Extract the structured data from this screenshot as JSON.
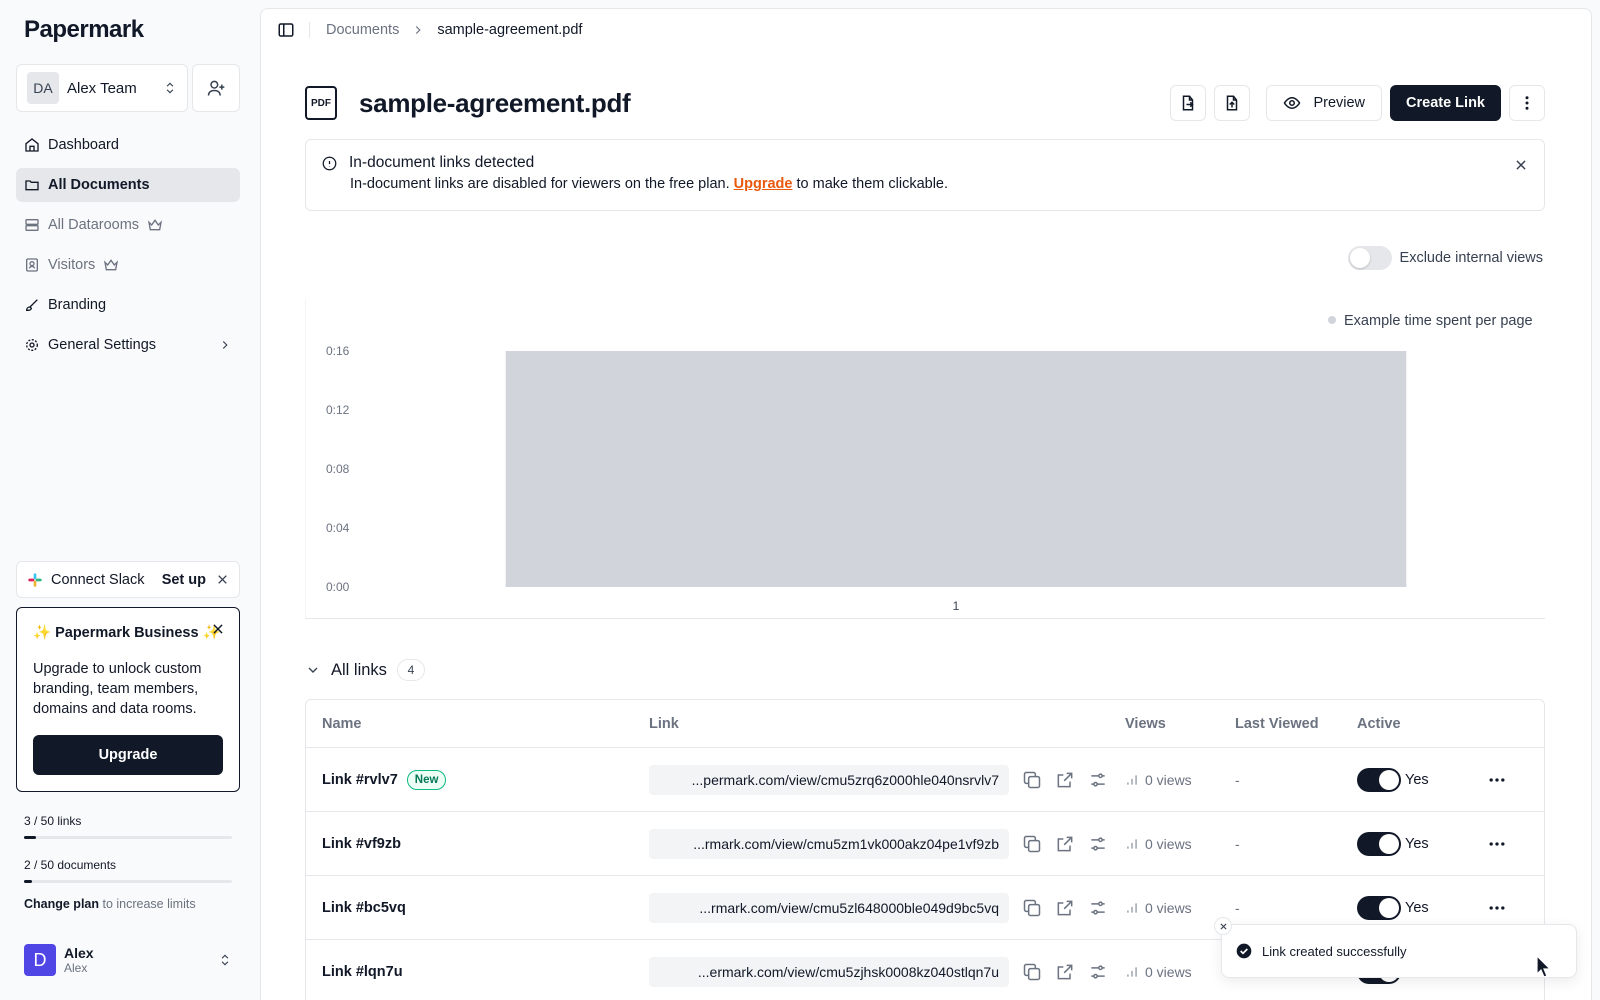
{
  "sidebar": {
    "logo": "Papermark",
    "team": {
      "initials": "DA",
      "name": "Alex Team"
    },
    "nav": [
      {
        "label": "Dashboard"
      },
      {
        "label": "All Documents"
      },
      {
        "label": "All Datarooms"
      },
      {
        "label": "Visitors"
      },
      {
        "label": "Branding"
      },
      {
        "label": "General Settings"
      }
    ],
    "slack": {
      "label": "Connect Slack",
      "action": "Set up"
    },
    "business": {
      "title": "✨ Papermark Business ✨",
      "text": "Upgrade to unlock custom branding, team members, domains and data rooms.",
      "button": "Upgrade"
    },
    "limits": [
      {
        "label": "3 / 50 links",
        "fraction": 0.06
      },
      {
        "label": "2 / 50 documents",
        "fraction": 0.04
      }
    ],
    "change_plan": {
      "bold": "Change plan",
      "rest": " to increase limits"
    },
    "user": {
      "initial": "D",
      "name": "Alex",
      "sub": "Alex"
    }
  },
  "breadcrumb": {
    "parent": "Documents",
    "current": "sample-agreement.pdf"
  },
  "document": {
    "badge": "PDF",
    "title": "sample-agreement.pdf",
    "preview_label": "Preview",
    "create_label": "Create Link"
  },
  "alert": {
    "title": "In-document links detected",
    "body_before": "In-document links are disabled for viewers on the free plan. ",
    "link": "Upgrade",
    "body_after": " to make them clickable."
  },
  "exclude_toggle": {
    "label": "Exclude internal views",
    "on": false
  },
  "chart_data": {
    "type": "bar",
    "legend": "Example time spent per page",
    "categories": [
      "1"
    ],
    "values": [
      16
    ],
    "ytick_labels": [
      "0:00",
      "0:04",
      "0:08",
      "0:12",
      "0:16"
    ],
    "ytick_values": [
      0,
      4,
      8,
      12,
      16
    ],
    "ylim": [
      0,
      16
    ],
    "bar_color": "#d1d5db",
    "grid": false,
    "legend_position": "top-right"
  },
  "links": {
    "heading": "All links",
    "count": "4",
    "columns": {
      "name": "Name",
      "link": "Link",
      "views": "Views",
      "last": "Last Viewed",
      "active": "Active"
    },
    "rows": [
      {
        "name": "Link #rvlv7",
        "badge": "New",
        "url": "...permark.com/view/cmu5zrq6z000hle040nsrvlv7",
        "views": "0 views",
        "last": "-",
        "active": "Yes"
      },
      {
        "name": "Link #vf9zb",
        "badge": "",
        "url": "...rmark.com/view/cmu5zm1vk000akz04pe1vf9zb",
        "views": "0 views",
        "last": "-",
        "active": "Yes"
      },
      {
        "name": "Link #bc5vq",
        "badge": "",
        "url": "...rmark.com/view/cmu5zl648000ble049d9bc5vq",
        "views": "0 views",
        "last": "-",
        "active": "Yes"
      },
      {
        "name": "Link #lqn7u",
        "badge": "",
        "url": "...ermark.com/view/cmu5zjhsk0008kz040stlqn7u",
        "views": "0 views",
        "last": "-",
        "active": "Yes"
      }
    ]
  },
  "toast": {
    "message": "Link created successfully"
  }
}
